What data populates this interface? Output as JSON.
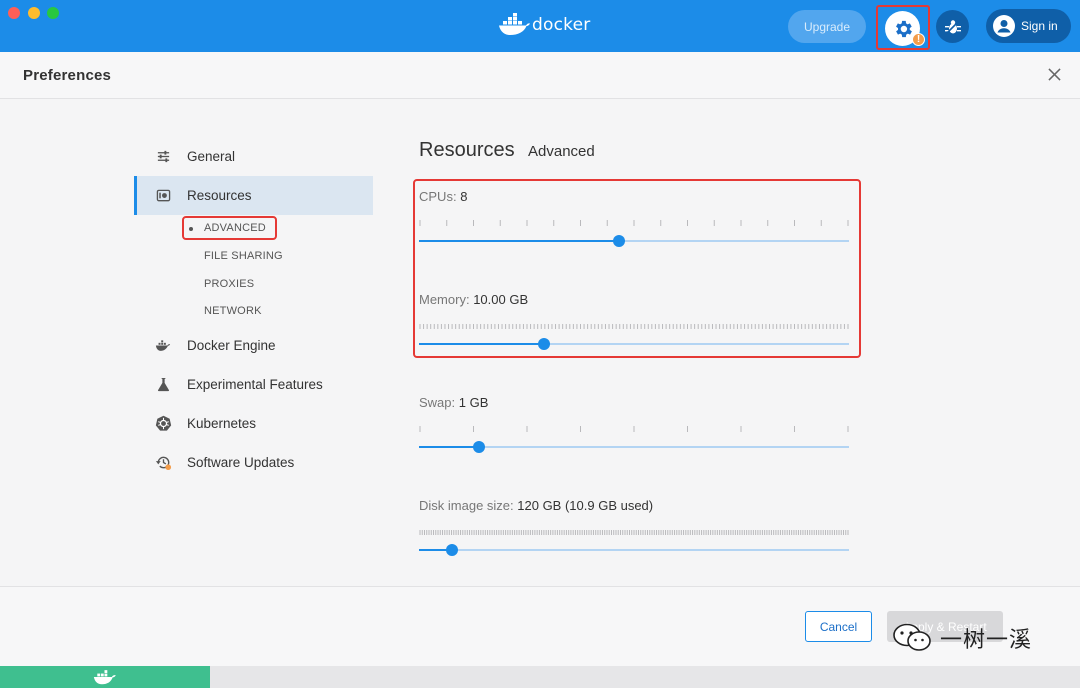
{
  "titlebar": {
    "brand": "docker",
    "upgrade_label": "Upgrade",
    "signin_label": "Sign in",
    "warning_badge": "!",
    "accent_color": "#1c8ce8"
  },
  "header": {
    "title": "Preferences",
    "close_glyph": "✕"
  },
  "sidebar": {
    "items": [
      {
        "label": "General",
        "icon": "sliders-icon"
      },
      {
        "label": "Resources",
        "icon": "resources-icon",
        "active": true
      },
      {
        "label": "Docker Engine",
        "icon": "whale-icon"
      },
      {
        "label": "Experimental Features",
        "icon": "flask-icon"
      },
      {
        "label": "Kubernetes",
        "icon": "kubernetes-icon"
      },
      {
        "label": "Software Updates",
        "icon": "update-icon"
      }
    ],
    "sub_items": [
      "ADVANCED",
      "FILE SHARING",
      "PROXIES",
      "NETWORK"
    ]
  },
  "main": {
    "title": "Resources",
    "subtitle": "Advanced",
    "cpus": {
      "label": "CPUs:",
      "value": "8",
      "fraction": 0.466
    },
    "memory": {
      "label": "Memory:",
      "value": "10.00 GB",
      "fraction": 0.29
    },
    "swap": {
      "label": "Swap:",
      "value": "1 GB",
      "fraction": 0.14
    },
    "disk": {
      "label": "Disk image size:",
      "value": "120 GB (10.9 GB used)",
      "fraction": 0.077
    }
  },
  "footer": {
    "cancel_label": "Cancel",
    "apply_label": "Apply & Restart",
    "watermark_text": "一树一溪"
  }
}
